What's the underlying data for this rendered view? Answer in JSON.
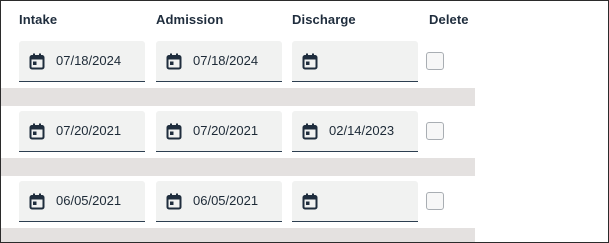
{
  "headers": {
    "intake": "Intake",
    "admission": "Admission",
    "discharge": "Discharge",
    "delete": "Delete"
  },
  "rows": [
    {
      "intake": "07/18/2024",
      "admission": "07/18/2024",
      "discharge": "",
      "delete_checked": false
    },
    {
      "intake": "07/20/2021",
      "admission": "07/20/2021",
      "discharge": "02/14/2023",
      "delete_checked": false
    },
    {
      "intake": "06/05/2021",
      "admission": "06/05/2021",
      "discharge": "",
      "delete_checked": false
    }
  ],
  "icons": {
    "date_field": "calendar-icon"
  },
  "colors": {
    "field_bg": "#f1f2f1",
    "field_underline": "#2c3e50",
    "separator": "#e4e1e0",
    "text": "#1d2a37",
    "header_text": "#1f2d3d",
    "icon": "#1f2d3d",
    "checkbox_border": "#a9aeb3"
  }
}
